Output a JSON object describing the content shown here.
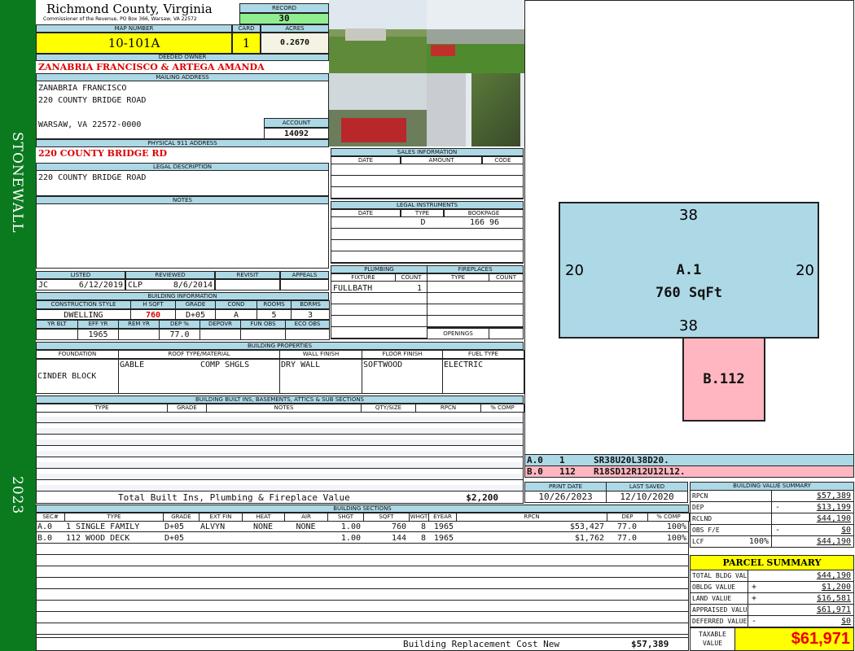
{
  "sidebar": {
    "district": "STONEWALL",
    "year": "2023"
  },
  "header": {
    "county": "Richmond County, Virginia",
    "commissioner": "Commissioner of the Revenue, PO Box 366, Warsaw, VA 22572",
    "record_label": "RECORD",
    "record": "30"
  },
  "map": {
    "map_label": "MAP NUMBER",
    "map_number": "10-101A",
    "card_label": "CARD",
    "card": "1",
    "acres_label": "ACRES",
    "acres": "0.2670"
  },
  "owner": {
    "label": "DEEDED OWNER",
    "value": "ZANABRIA FRANCISCO & ARTEGA AMANDA"
  },
  "mailing": {
    "label": "MAILING ADDRESS",
    "lines": [
      "ZANABRIA FRANCISCO",
      "220 COUNTY BRIDGE ROAD",
      "WARSAW, VA 22572-0000"
    ]
  },
  "account": {
    "label": "ACCOUNT",
    "value": "14092"
  },
  "physical": {
    "label": "PHYSICAL 911 ADDRESS",
    "value": "220 COUNTY BRIDGE RD"
  },
  "legal": {
    "label": "LEGAL DESCRIPTION",
    "value": "220 COUNTY BRIDGE ROAD"
  },
  "notes": {
    "label": "NOTES"
  },
  "listing": {
    "labels": [
      "LISTED",
      "REVIEWED",
      "REVISIT",
      "APPEALS"
    ],
    "listed_by": "JC",
    "listed_date": "6/12/2019",
    "reviewed_by": "CLP",
    "reviewed_date": "8/6/2014"
  },
  "building_info": {
    "title": "BUILDING INFORMATION",
    "labels1": [
      "CONSTRUCTION STYLE",
      "H SQFT",
      "GRADE",
      "COND",
      "ROOMS",
      "BDRMS"
    ],
    "values1": [
      "DWELLING",
      "760",
      "D+05",
      "A",
      "5",
      "3"
    ],
    "labels2": [
      "YR BLT",
      "EFF YR",
      "REM YR",
      "DEP %",
      "DEPOVR",
      "FUN OBS",
      "ECO OBS"
    ],
    "values2": [
      "",
      "1965",
      "",
      "77.0",
      "",
      "",
      ""
    ]
  },
  "sales": {
    "title": "SALES INFORMATION",
    "cols": [
      "DATE",
      "AMOUNT",
      "CODE"
    ]
  },
  "legal_instruments": {
    "title": "LEGAL INSTRUMENTS",
    "cols": [
      "DATE",
      "TYPE",
      "BOOKPAGE"
    ],
    "rows": [
      {
        "date": "",
        "type": "D",
        "bookpage": "166 96"
      }
    ]
  },
  "plumbing": {
    "title": "PLUMBING",
    "cols": [
      "FIXTURE",
      "COUNT"
    ],
    "rows": [
      {
        "fixture": "FULLBATH",
        "count": "1"
      }
    ]
  },
  "fireplaces": {
    "title": "FIREPLACES",
    "cols": [
      "TYPE",
      "COUNT"
    ],
    "openings_label": "OPENINGS"
  },
  "properties": {
    "title": "BUILDING PROPERTIES",
    "cols": [
      "FOUNDATION",
      "ROOF TYPE/MATERIAL",
      "WALL FINISH",
      "FLOOR FINISH",
      "FUEL TYPE"
    ],
    "foundation": "CINDER BLOCK",
    "roof_type": "GABLE",
    "roof_material": "COMP SHGLS",
    "wall": "DRY WALL",
    "floor": "SOFTWOOD",
    "fuel": "ELECTRIC"
  },
  "builtins": {
    "title": "BUILDING BUILT INS, BASEMENTS, ATTICS & SUB SECTIONS",
    "cols": [
      "TYPE",
      "GRADE",
      "NOTES",
      "QTY/SIZE",
      "RPCN",
      "% COMP"
    ],
    "total_label": "Total Built Ins, Plumbing & Fireplace Value",
    "total_value": "$2,200"
  },
  "sections": {
    "title": "BUILDING SECTIONS",
    "cols": [
      "SEC#",
      "TYPE",
      "GRADE",
      "EXT FIN",
      "HEAT",
      "AIR",
      "SHGT",
      "SQFT",
      "WHGT",
      "EYEAR",
      "RPCN",
      "DEP",
      "% COMP"
    ],
    "rows": [
      [
        "A.0",
        "1 SINGLE FAMILY",
        "D+05",
        "ALVYN",
        "NONE",
        "NONE",
        "1.00",
        "760",
        "8",
        "1965",
        "$53,427",
        "77.0",
        "100%"
      ],
      [
        "B.0",
        "112 WOOD DECK",
        "D+05",
        "",
        "",
        "",
        "1.00",
        "144",
        "8",
        "1965",
        "$1,762",
        "77.0",
        "100%"
      ]
    ],
    "replacement_label": "Building Replacement Cost New",
    "replacement_value": "$57,389"
  },
  "sketch": {
    "top": "38",
    "left": "20",
    "right": "20",
    "bottom": "38",
    "a_label": "A.1",
    "a_area": "760 SqFt",
    "b_label": "B.112",
    "colors": {
      "a": "#add8e6",
      "b": "#ffb6c1"
    }
  },
  "sketch_codes": [
    [
      "A.0",
      "1",
      "SR38U20L38D20."
    ],
    [
      "B.0",
      "112",
      "R18SD12R12U12L12."
    ]
  ],
  "dates": {
    "print_label": "PRINT DATE",
    "print_date": "10/26/2023",
    "saved_label": "LAST SAVED",
    "saved_date": "12/10/2020"
  },
  "bvs": {
    "title": "BUILDING VALUE SUMMARY",
    "rows": [
      {
        "label": "RPCN",
        "op": "",
        "value": "$57,389"
      },
      {
        "label": "DEP",
        "op": "-",
        "value": "$13,199"
      },
      {
        "label": "RCLND",
        "op": "",
        "value": "$44,190"
      },
      {
        "label": "OBS F/E",
        "op": "-",
        "value": "$0"
      },
      {
        "label": "LCF",
        "pct": "100%",
        "op": "",
        "value": "$44,190"
      }
    ]
  },
  "parcel": {
    "title": "PARCEL SUMMARY",
    "rows": [
      {
        "label": "TOTAL BLDG VALUE",
        "op": "",
        "value": "$44,190"
      },
      {
        "label": "OBLDG VALUE",
        "op": "+",
        "value": "$1,200"
      },
      {
        "label": "LAND VALUE",
        "op": "+",
        "value": "$16,581"
      },
      {
        "label": "APPRAISED VALUE",
        "op": "",
        "value": "$61,971"
      },
      {
        "label": "DEFERRED VALUE",
        "op": "-",
        "value": "$0"
      }
    ],
    "taxable_label": "TAXABLE VALUE",
    "taxable_value": "$61,971"
  }
}
